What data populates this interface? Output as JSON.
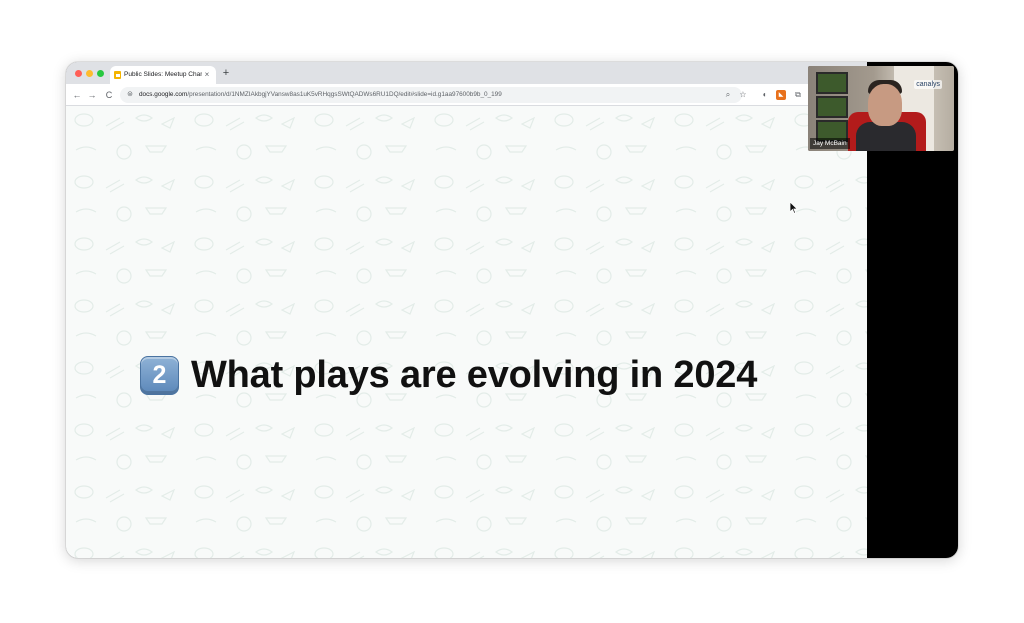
{
  "browser": {
    "tab": {
      "title": "Public Slides: Meetup Chann",
      "close": "×"
    },
    "new_tab": "+",
    "nav": {
      "back": "←",
      "forward": "→",
      "reload": "C"
    },
    "address": {
      "host": "docs.google.com",
      "path": "/presentation/d/1NMZIAkbgjYVansw8as1uK5vRHqgsSWtQADWs6RU1DQ/edit#slide=id.g1aa97600b9b_0_199"
    },
    "omnibox_icons": {
      "zoom": "zoom-icon",
      "bookmark": "star-icon"
    },
    "extensions": [
      "extension-icon",
      "rss-icon",
      "puzzle-icon"
    ]
  },
  "slide": {
    "number_badge": "2",
    "title": "What plays are evolving in 2024"
  },
  "video_call": {
    "participant_name": "Jay McBain",
    "brand_overlay": "canalys"
  },
  "colors": {
    "tab_strip": "#dfe1e5",
    "slide_background": "#f8faf9",
    "badge": "#6f95c4",
    "call_panel": "#000000"
  }
}
